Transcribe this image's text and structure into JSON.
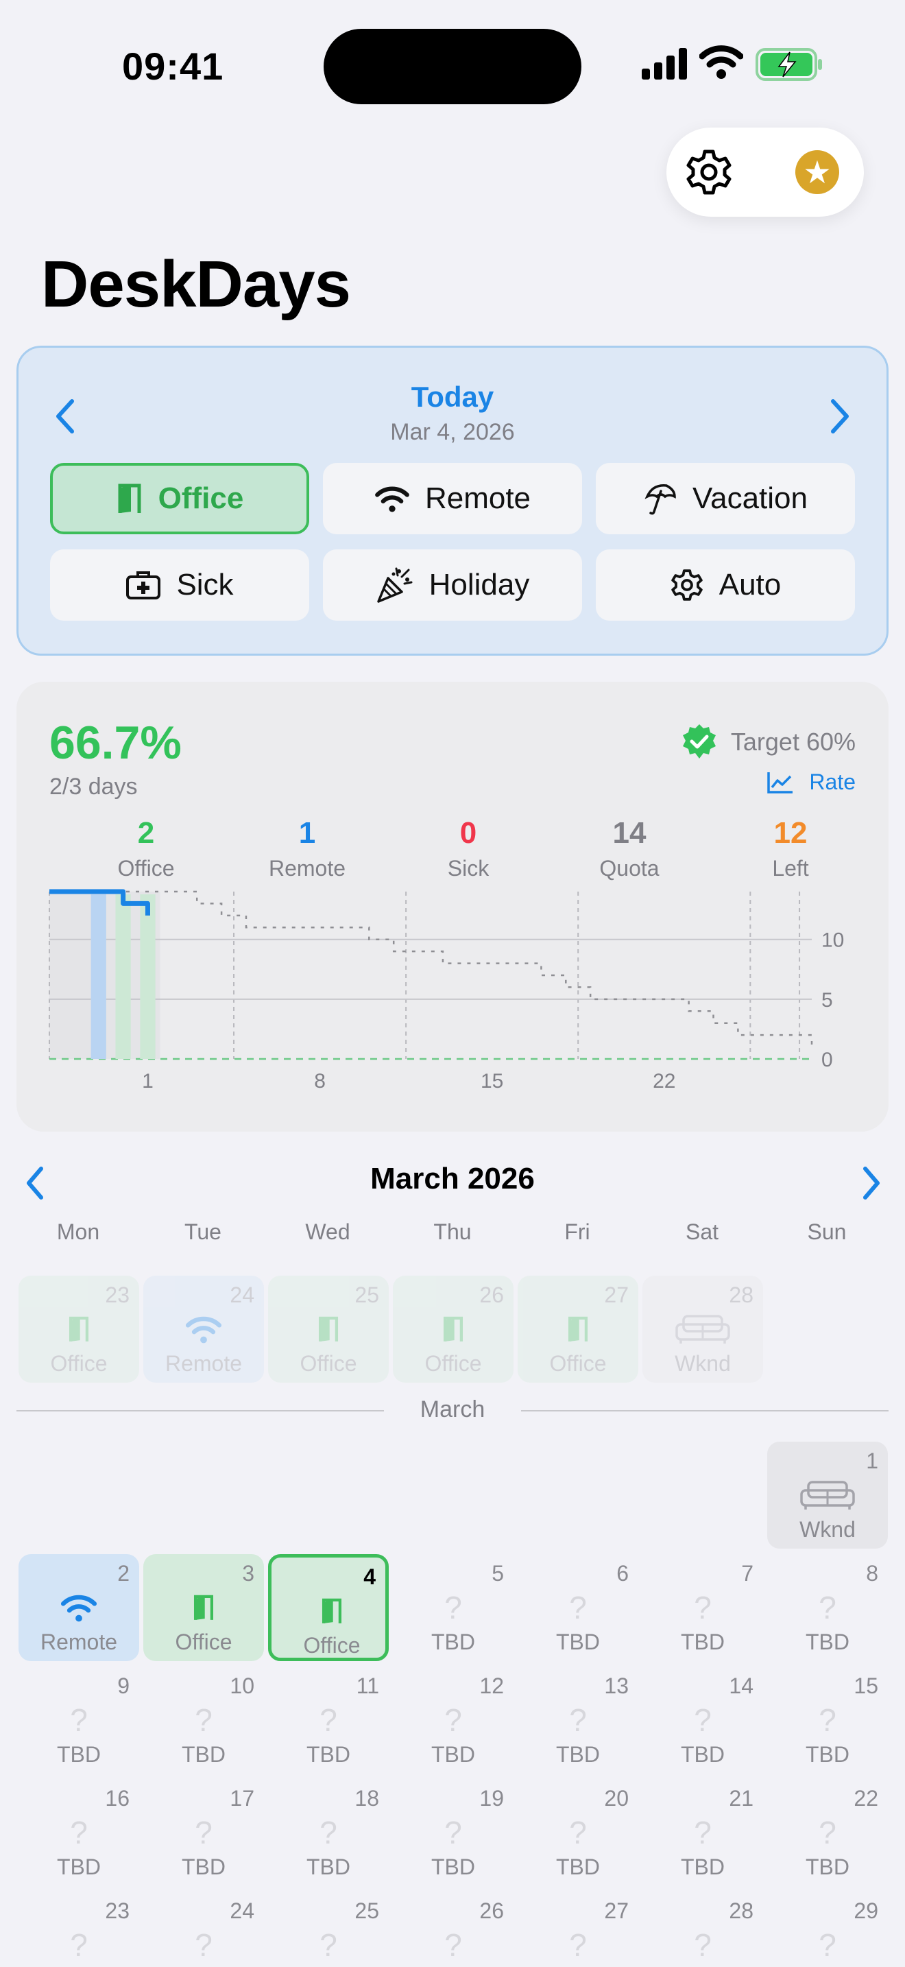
{
  "status_bar": {
    "time": "09:41"
  },
  "app": {
    "title": "DeskDays"
  },
  "today_card": {
    "heading": "Today",
    "date": "Mar 4, 2026",
    "selected": "Office",
    "buttons": [
      {
        "label": "Office",
        "icon": "door-icon"
      },
      {
        "label": "Remote",
        "icon": "wifi-icon"
      },
      {
        "label": "Vacation",
        "icon": "umbrella-icon"
      },
      {
        "label": "Sick",
        "icon": "medical-bag-icon"
      },
      {
        "label": "Holiday",
        "icon": "party-popper-icon"
      },
      {
        "label": "Auto",
        "icon": "gear-icon"
      }
    ]
  },
  "stats": {
    "percent": "66.7%",
    "days": "2/3 days",
    "target": "Target 60%",
    "rate_label": "Rate",
    "items": [
      {
        "value": "2",
        "label": "Office",
        "color": "#33c25a"
      },
      {
        "value": "1",
        "label": "Remote",
        "color": "#1a84e5"
      },
      {
        "value": "0",
        "label": "Sick",
        "color": "#f0364b"
      },
      {
        "value": "14",
        "label": "Quota",
        "color": "#7f7f86"
      },
      {
        "value": "12",
        "label": "Left",
        "color": "#f28b2a"
      }
    ]
  },
  "chart_data": {
    "type": "line",
    "x_ticks": [
      "1",
      "8",
      "15",
      "22"
    ],
    "y_ticks": [
      "10",
      "5",
      "0"
    ],
    "ylim": [
      0,
      14
    ],
    "xlim": [
      -3,
      28
    ],
    "series": [
      {
        "points": [
          [
            -3,
            14
          ],
          [
            -2,
            14
          ],
          [
            -1,
            14
          ],
          [
            0,
            14
          ],
          [
            1,
            14
          ],
          [
            2,
            14
          ],
          [
            3,
            13
          ],
          [
            4,
            12
          ],
          [
            5,
            11
          ],
          [
            6,
            11
          ],
          [
            7,
            11
          ],
          [
            8,
            11
          ],
          [
            9,
            11
          ],
          [
            10,
            10
          ],
          [
            11,
            9
          ],
          [
            12,
            9
          ],
          [
            13,
            8
          ],
          [
            14,
            8
          ],
          [
            15,
            8
          ],
          [
            16,
            8
          ],
          [
            17,
            7
          ],
          [
            18,
            6
          ],
          [
            19,
            5
          ],
          [
            20,
            5
          ],
          [
            21,
            5
          ],
          [
            22,
            5
          ],
          [
            23,
            4
          ],
          [
            24,
            3
          ],
          [
            25,
            2
          ],
          [
            26,
            2
          ],
          [
            27,
            2
          ],
          [
            28,
            1
          ]
        ]
      },
      {
        "points": [
          [
            -3,
            14
          ],
          [
            -2,
            14
          ],
          [
            -1,
            14
          ],
          [
            0,
            13
          ],
          [
            1,
            13
          ],
          [
            1,
            12
          ]
        ]
      }
    ],
    "bars": [
      {
        "x": -1,
        "type": "remote"
      },
      {
        "x": 0,
        "type": "office"
      },
      {
        "x": 1,
        "type": "office"
      }
    ]
  },
  "calendar": {
    "month_title": "March 2026",
    "weekdays": [
      "Mon",
      "Tue",
      "Wed",
      "Thu",
      "Fri",
      "Sat",
      "Sun"
    ],
    "divider_label": "March",
    "prev_week": [
      {
        "day": "23",
        "label": "Office",
        "kind": "office"
      },
      {
        "day": "24",
        "label": "Remote",
        "kind": "remote"
      },
      {
        "day": "25",
        "label": "Office",
        "kind": "office"
      },
      {
        "day": "26",
        "label": "Office",
        "kind": "office"
      },
      {
        "day": "27",
        "label": "Office",
        "kind": "office"
      },
      {
        "day": "28",
        "label": "Wknd",
        "kind": "wknd"
      }
    ],
    "march_first": {
      "day": "1",
      "label": "Wknd",
      "kind": "wknd"
    },
    "week2": [
      {
        "day": "2",
        "label": "Remote",
        "kind": "remote"
      },
      {
        "day": "3",
        "label": "Office",
        "kind": "office"
      },
      {
        "day": "4",
        "label": "Office",
        "kind": "today"
      },
      {
        "day": "5",
        "label": "TBD",
        "kind": "tbd"
      },
      {
        "day": "6",
        "label": "TBD",
        "kind": "tbd"
      },
      {
        "day": "7",
        "label": "TBD",
        "kind": "tbd"
      },
      {
        "day": "8",
        "label": "TBD",
        "kind": "tbd"
      }
    ],
    "week3": [
      {
        "day": "9",
        "label": "TBD"
      },
      {
        "day": "10",
        "label": "TBD"
      },
      {
        "day": "11",
        "label": "TBD"
      },
      {
        "day": "12",
        "label": "TBD"
      },
      {
        "day": "13",
        "label": "TBD"
      },
      {
        "day": "14",
        "label": "TBD"
      },
      {
        "day": "15",
        "label": "TBD"
      }
    ],
    "week4": [
      {
        "day": "16",
        "label": "TBD"
      },
      {
        "day": "17",
        "label": "TBD"
      },
      {
        "day": "18",
        "label": "TBD"
      },
      {
        "day": "19",
        "label": "TBD"
      },
      {
        "day": "20",
        "label": "TBD"
      },
      {
        "day": "21",
        "label": "TBD"
      },
      {
        "day": "22",
        "label": "TBD"
      }
    ],
    "week5": [
      {
        "day": "23"
      },
      {
        "day": "24"
      },
      {
        "day": "25"
      },
      {
        "day": "26"
      },
      {
        "day": "27"
      },
      {
        "day": "28"
      },
      {
        "day": "29"
      }
    ]
  }
}
